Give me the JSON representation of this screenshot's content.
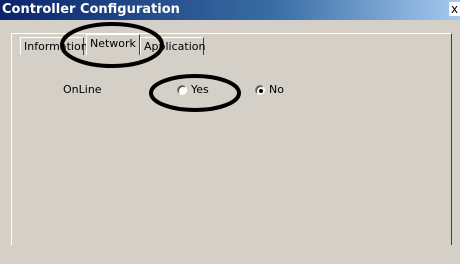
{
  "window": {
    "title": "Controller Configuration",
    "close_label": "x"
  },
  "tabs": [
    {
      "label": "Information",
      "active": false
    },
    {
      "label": "Network",
      "active": true
    },
    {
      "label": "Application",
      "active": false
    }
  ],
  "network": {
    "online_label": "OnLine",
    "options": [
      {
        "label": "Yes",
        "selected": false
      },
      {
        "label": "No",
        "selected": true
      }
    ]
  },
  "colors": {
    "titlebar_start": "#0a246a",
    "titlebar_end": "#a6caf0",
    "dialog_face": "#d4d0c8",
    "annotation_stroke": "#000000"
  }
}
